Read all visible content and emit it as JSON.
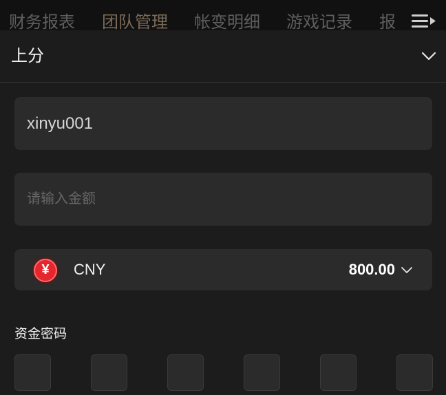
{
  "top_nav": {
    "tabs": [
      "财务报表",
      "团队管理",
      "帐变明细",
      "游戏记录",
      "报"
    ],
    "active_index": 1,
    "menu_icon": "menu-arrow-icon"
  },
  "sheet": {
    "title": "上分",
    "collapse_icon": "chevron-down-icon"
  },
  "form": {
    "username_value": "xinyu001",
    "amount_placeholder": "请输入金额",
    "amount_value": "",
    "currency": {
      "icon": "yuan-coin-icon",
      "symbol": "¥",
      "code": "CNY",
      "balance": "800.00"
    },
    "password_label": "资金密码",
    "password_length": 6
  },
  "colors": {
    "background": "#1c1c1c",
    "field_bg": "#2b2b2b",
    "active_tab": "#7a6a57",
    "coin_red": "#e6262e"
  }
}
